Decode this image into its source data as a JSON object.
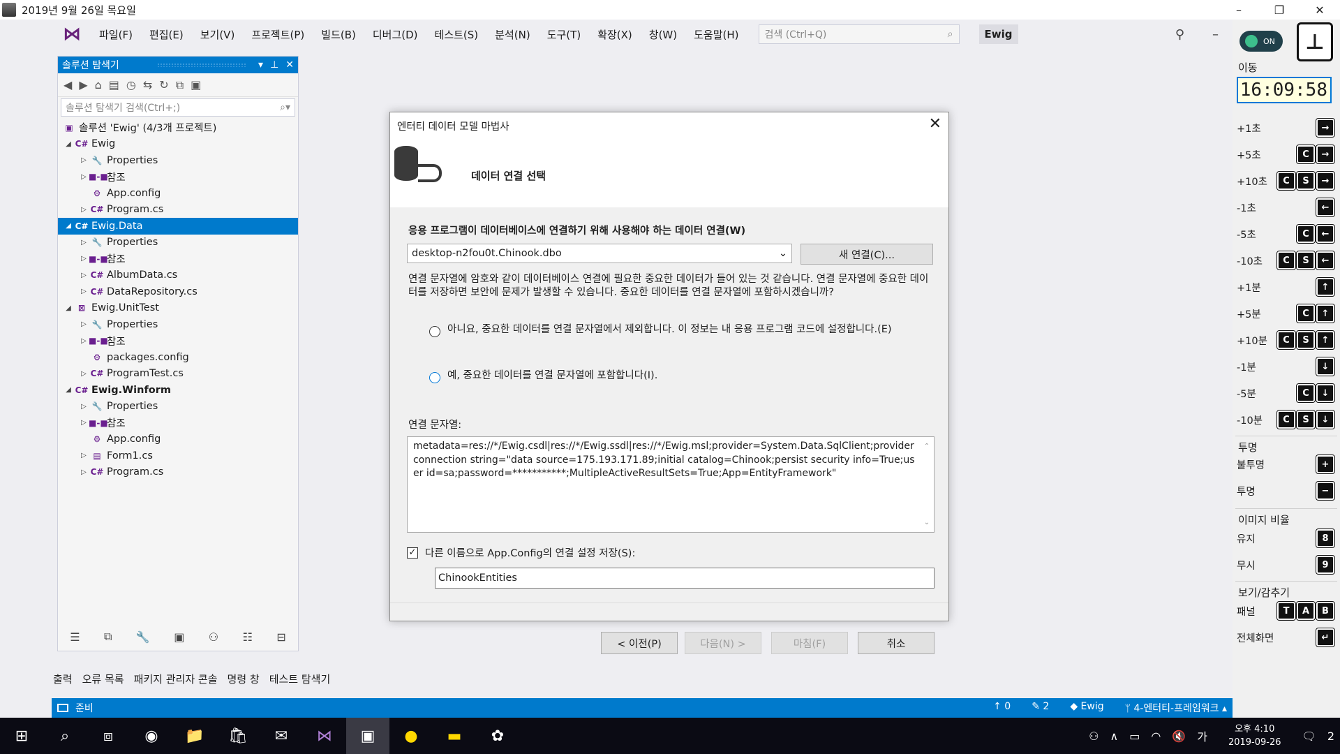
{
  "titlebar": {
    "title": "2019년 9월 26일 목요일",
    "minimize": "–",
    "restore": "❐",
    "close": "✕"
  },
  "menubar": {
    "items": [
      "파일(F)",
      "편집(E)",
      "보기(V)",
      "프로젝트(P)",
      "빌드(B)",
      "디버그(D)",
      "테스트(S)",
      "분석(N)",
      "도구(T)",
      "확장(X)",
      "창(W)",
      "도움말(H)"
    ],
    "search_placeholder": "검색 (Ctrl+Q)",
    "project": "Ewig"
  },
  "solution_explorer": {
    "title": "솔루션 탐색기",
    "search_placeholder": "솔루션 탐색기 검색(Ctrl+;)",
    "nodes": [
      "솔루션 'Ewig' (4/3개 프로젝트)",
      "Ewig",
      "Properties",
      "참조",
      "App.config",
      "Program.cs",
      "Ewig.Data",
      "Properties",
      "참조",
      "AlbumData.cs",
      "DataRepository.cs",
      "Ewig.UnitTest",
      "Properties",
      "참조",
      "packages.config",
      "ProgramTest.cs",
      "Ewig.Winform",
      "Properties",
      "참조",
      "App.config",
      "Form1.cs",
      "Program.cs"
    ]
  },
  "bottom_tabs": [
    "출력",
    "오류 목록",
    "패키지 관리자 콘솔",
    "명령 창",
    "테스트 탐색기"
  ],
  "status": {
    "ready": "준비",
    "up": "↑ 0",
    "edits": "✎ 2",
    "repo": "◆ Ewig",
    "branch": "ᛘ 4-엔터티-프레임워크 ▴"
  },
  "taskbar": {
    "time": "오후 4:10",
    "date": "2019-09-26",
    "ime": "가",
    "notifications": "2"
  },
  "dialog": {
    "title": "엔터티 데이터 모델 마법사",
    "heading": "데이터 연결 선택",
    "conn_label": "응용 프로그램이 데이터베이스에 연결하기 위해 사용해야 하는 데이터 연결(W)",
    "conn_value": "desktop-n2fou0t.Chinook.dbo",
    "new_conn": "새 연결(C)...",
    "warning": "연결 문자열에 암호와 같이 데이터베이스 연결에 필요한 중요한 데이터가 들어 있는 것 같습니다. 연결 문자열에 중요한 데이터를 저장하면 보안에 문제가 발생할 수 있습니다. 중요한 데이터를 연결 문자열에 포함하시겠습니까?",
    "radio_no": "아니요, 중요한 데이터를 연결 문자열에서 제외합니다. 이 정보는 내 응용 프로그램 코드에 설정합니다.(E)",
    "radio_yes": "예, 중요한 데이터를 연결 문자열에 포함합니다(I).",
    "cs_label": "연결 문자열:",
    "conn_string": "metadata=res://*/Ewig.csdl|res://*/Ewig.ssdl|res://*/Ewig.msl;provider=System.Data.SqlClient;provider connection string=\"data source=175.193.171.89;initial catalog=Chinook;persist security info=True;user id=sa;password=***********;MultipleActiveResultSets=True;App=EntityFramework\"",
    "save_label": "다른 이름으로 App.Config의 연결 설정 저장(S):",
    "entity_name": "ChinookEntities",
    "btn_prev": "< 이전(P)",
    "btn_next": "다음(N) >",
    "btn_finish": "마침(F)",
    "btn_cancel": "취소"
  },
  "right_panel": {
    "toggle": "ON",
    "section_move": "이동",
    "time": "16:09:58",
    "rows": [
      {
        "label": "+1초",
        "keys": [
          "→"
        ]
      },
      {
        "label": "+5초",
        "keys": [
          "C",
          "→"
        ]
      },
      {
        "label": "+10초",
        "keys": [
          "C",
          "S",
          "→"
        ]
      },
      {
        "label": "-1초",
        "keys": [
          "←"
        ]
      },
      {
        "label": "-5초",
        "keys": [
          "C",
          "←"
        ]
      },
      {
        "label": "-10초",
        "keys": [
          "C",
          "S",
          "←"
        ]
      },
      {
        "label": "+1분",
        "keys": [
          "↑"
        ]
      },
      {
        "label": "+5분",
        "keys": [
          "C",
          "↑"
        ]
      },
      {
        "label": "+10분",
        "keys": [
          "C",
          "S",
          "↑"
        ]
      },
      {
        "label": "-1분",
        "keys": [
          "↓"
        ]
      },
      {
        "label": "-5분",
        "keys": [
          "C",
          "↓"
        ]
      },
      {
        "label": "-10분",
        "keys": [
          "C",
          "S",
          "↓"
        ]
      }
    ],
    "section_opacity": "투명",
    "opaque": "불투명",
    "transparent": "투명",
    "section_ratio": "이미지 비율",
    "keep": "유지",
    "ignore": "무시",
    "section_view": "보기/감추기",
    "panel": "패널",
    "fullscreen": "전체화면"
  }
}
